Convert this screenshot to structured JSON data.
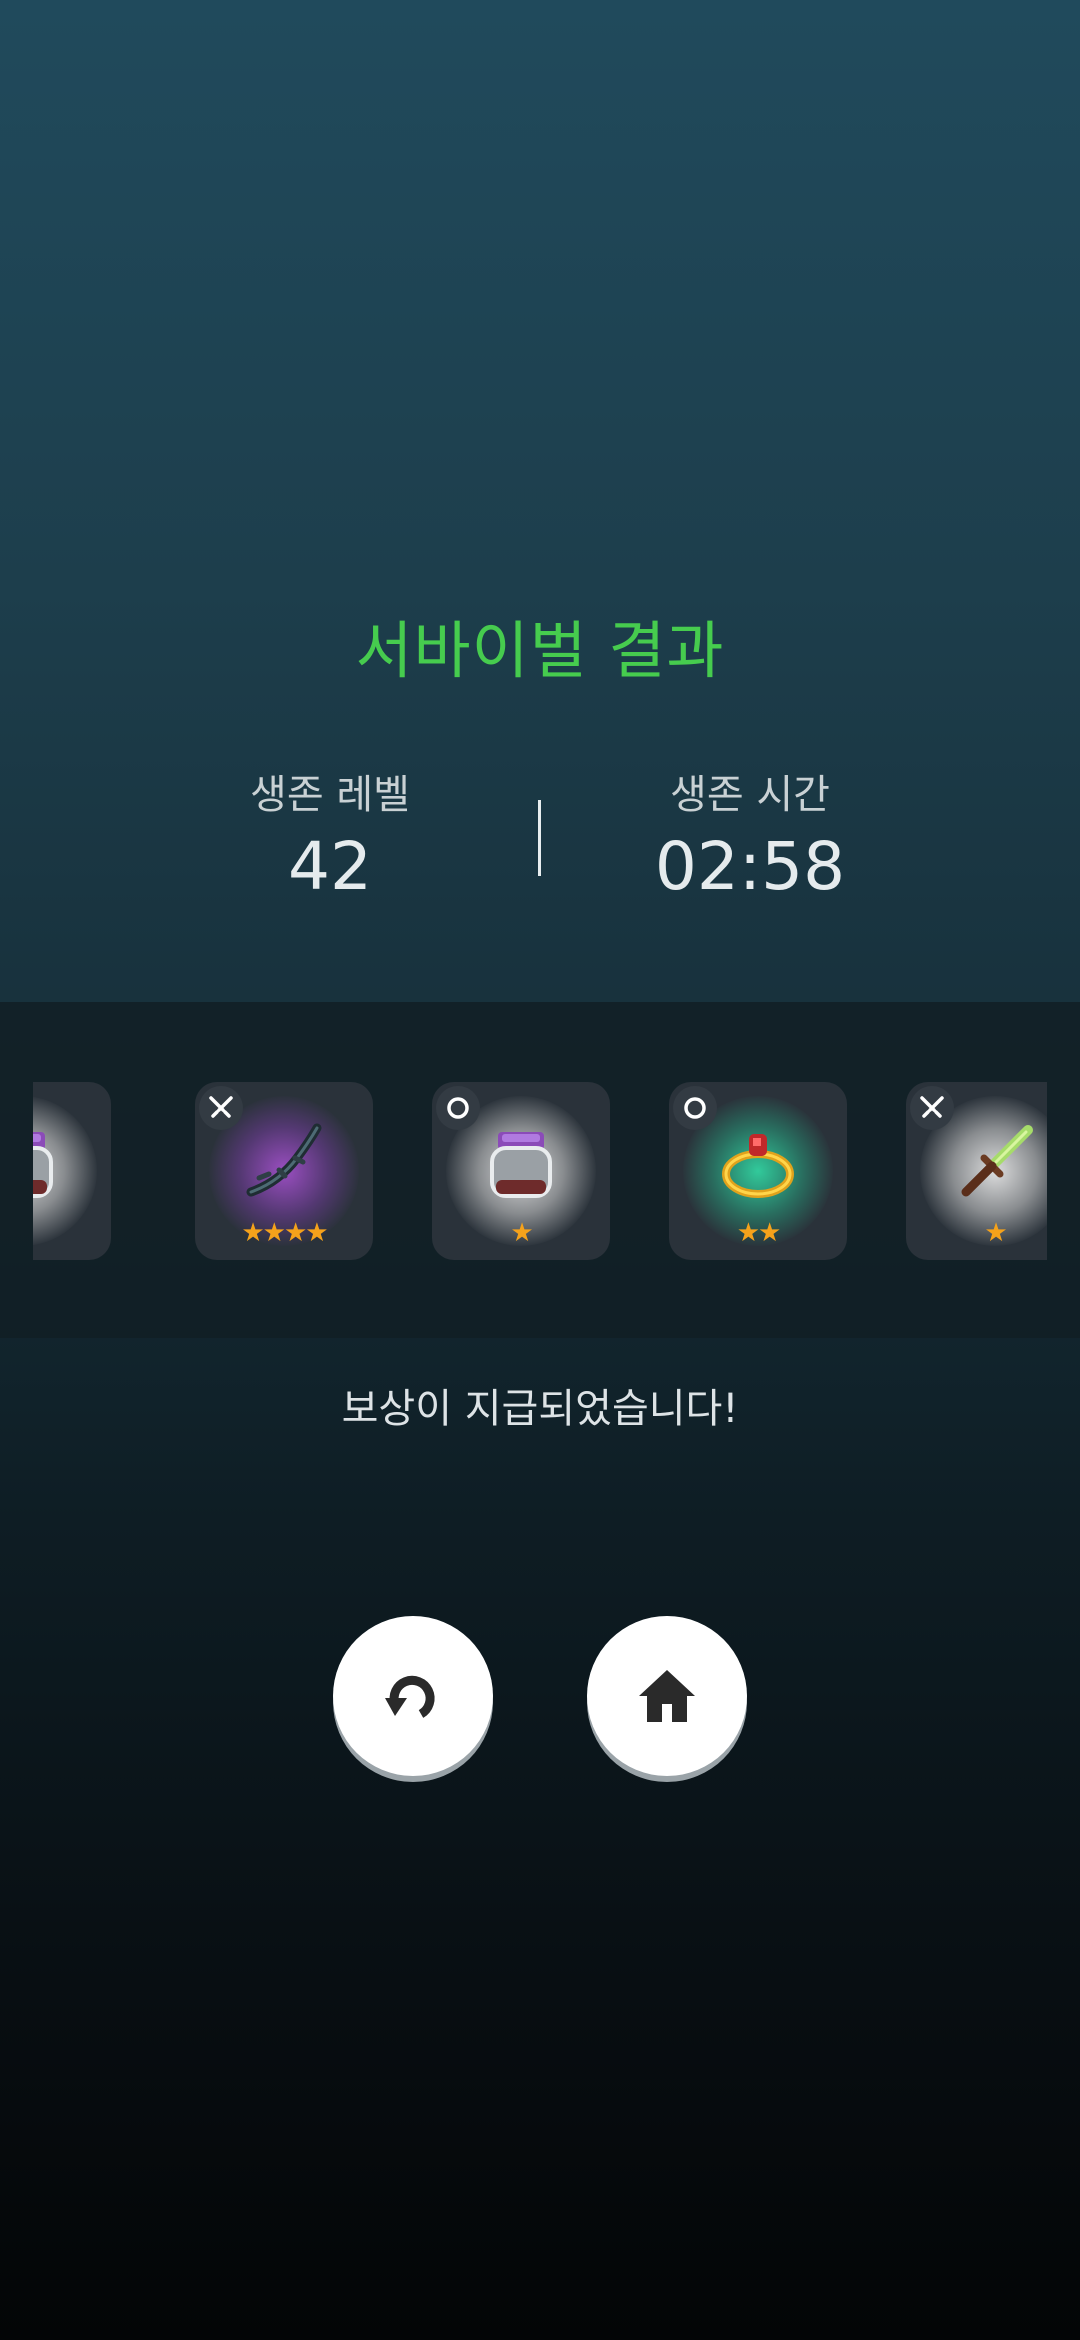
{
  "result": {
    "title": "서바이벌 결과",
    "level_label": "생존 레벨",
    "level_value": "42",
    "time_label": "생존 시간",
    "time_value": "02:58"
  },
  "rewards": [
    {
      "kind": "potion",
      "badge": "ring-icon",
      "glow": "white",
      "stars": "★",
      "partial": true
    },
    {
      "kind": "bow",
      "badge": "weapon-icon",
      "glow": "purple",
      "stars": "★★★★"
    },
    {
      "kind": "potion",
      "badge": "ring-icon",
      "glow": "white",
      "stars": "★"
    },
    {
      "kind": "ring",
      "badge": "ring-icon",
      "glow": "green",
      "stars": "★★"
    },
    {
      "kind": "dagger",
      "badge": "weapon-icon",
      "glow": "white",
      "stars": "★"
    }
  ],
  "reward_message": "보상이 지급되었습니다!",
  "buttons": {
    "retry_icon": "retry-icon",
    "home_icon": "home-icon"
  },
  "colors": {
    "title": "#46cc4e",
    "star": "#f5a21b"
  }
}
